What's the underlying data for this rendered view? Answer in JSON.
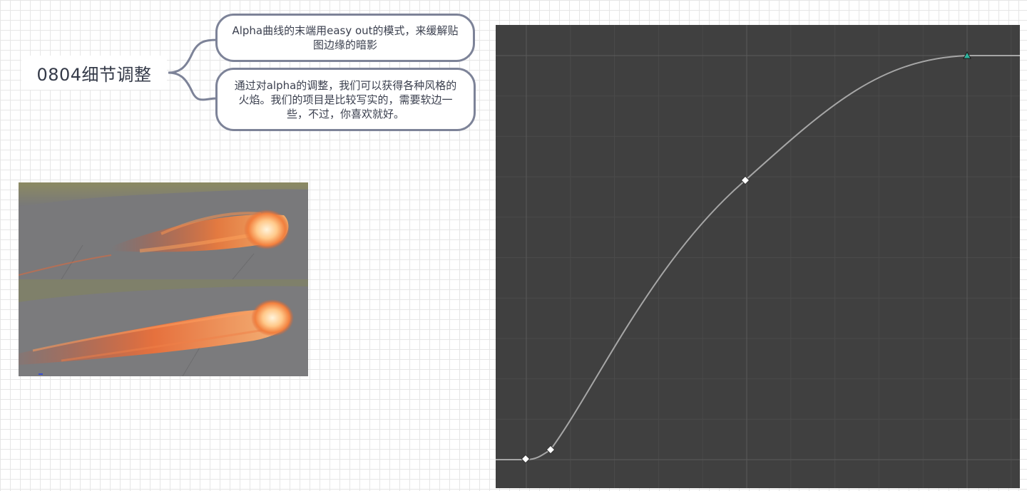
{
  "mindmap": {
    "topic": "0804细节调整",
    "notes": [
      "Alpha曲线的末端用easy out的模式，来缓解贴图边缘的暗影",
      "通过对alpha的调整，我们可以获得各种风格的火焰。我们的项目是比较写实的，需要软边一些，不过，你喜欢就好。"
    ]
  },
  "colors": {
    "graph_background": "#404040",
    "grid_minor": "#4a4a4a",
    "grid_major": "#5a5a5a",
    "curve": "#a6a6a6",
    "key": "#ffffff",
    "end_key": "#2fb39e",
    "note_border": "#7d8398"
  },
  "icons": [
    "key-diamond-icon",
    "key-triangle-icon"
  ]
}
